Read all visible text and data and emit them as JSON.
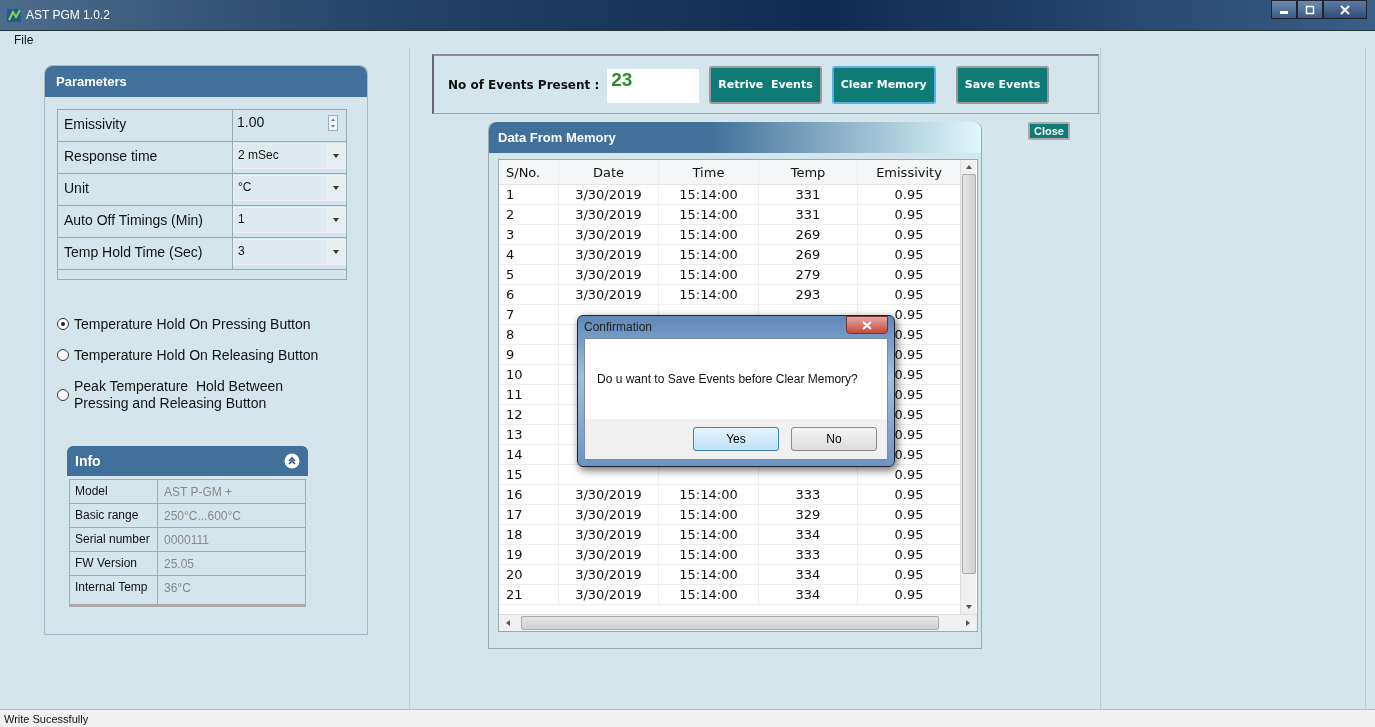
{
  "window": {
    "title": "AST PGM 1.0.2"
  },
  "menu": [
    "File"
  ],
  "parameters": {
    "title": "Parameters",
    "rows": [
      {
        "label": "Emissivity",
        "value": "1.00",
        "kind": "spinner"
      },
      {
        "label": "Response time",
        "value": "2 mSec",
        "kind": "dropdown"
      },
      {
        "label": "Unit",
        "value": "°C",
        "kind": "dropdown"
      },
      {
        "label": "Auto Off Timings (Min)",
        "value": "1",
        "kind": "dropdown"
      },
      {
        "label": "Temp Hold Time (Sec)",
        "value": "3",
        "kind": "dropdown"
      }
    ]
  },
  "hold_modes": [
    {
      "label": "Temperature Hold On Pressing Button",
      "selected": true
    },
    {
      "label": "Temperature Hold On Releasing Button",
      "selected": false
    },
    {
      "label": "Peak Temperature  Hold Between Pressing and Releasing Button",
      "selected": false
    }
  ],
  "info": {
    "title": "Info",
    "rows": [
      {
        "label": "Model",
        "value": "AST P-GM +"
      },
      {
        "label": "Basic range",
        "value": "250°C...600°C"
      },
      {
        "label": "Serial number",
        "value": "0000111"
      },
      {
        "label": "FW Version",
        "value": "25.05"
      },
      {
        "label": "Internal Temp",
        "value": "36°C"
      }
    ]
  },
  "events": {
    "label": "No of Events Present :",
    "count": "23"
  },
  "buttons": [
    {
      "label": "Retrive  Events",
      "focused": false
    },
    {
      "label": "Clear Memory",
      "focused": true
    },
    {
      "label": "Save Events",
      "focused": false
    }
  ],
  "close_button": "Close",
  "data_panel": {
    "title": "Data From Memory",
    "columns": [
      "S/No.",
      "Date",
      "Time",
      "Temp",
      "Emissivity"
    ],
    "rows": [
      {
        "sno": "1",
        "date": "3/30/2019",
        "time": "15:14:00",
        "temp": "331",
        "emissivity": "0.95"
      },
      {
        "sno": "2",
        "date": "3/30/2019",
        "time": "15:14:00",
        "temp": "331",
        "emissivity": "0.95"
      },
      {
        "sno": "3",
        "date": "3/30/2019",
        "time": "15:14:00",
        "temp": "269",
        "emissivity": "0.95"
      },
      {
        "sno": "4",
        "date": "3/30/2019",
        "time": "15:14:00",
        "temp": "269",
        "emissivity": "0.95"
      },
      {
        "sno": "5",
        "date": "3/30/2019",
        "time": "15:14:00",
        "temp": "279",
        "emissivity": "0.95"
      },
      {
        "sno": "6",
        "date": "3/30/2019",
        "time": "15:14:00",
        "temp": "293",
        "emissivity": "0.95"
      },
      {
        "sno": "7",
        "emissivity": "0.95"
      },
      {
        "sno": "8",
        "emissivity": "0.95"
      },
      {
        "sno": "9",
        "emissivity": "0.95"
      },
      {
        "sno": "10",
        "emissivity": "0.95"
      },
      {
        "sno": "11",
        "emissivity": "0.95"
      },
      {
        "sno": "12",
        "emissivity": "0.95"
      },
      {
        "sno": "13",
        "emissivity": "0.95"
      },
      {
        "sno": "14",
        "emissivity": "0.95"
      },
      {
        "sno": "15",
        "emissivity": "0.95"
      },
      {
        "sno": "16",
        "date": "3/30/2019",
        "time": "15:14:00",
        "temp": "333",
        "emissivity": "0.95"
      },
      {
        "sno": "17",
        "date": "3/30/2019",
        "time": "15:14:00",
        "temp": "329",
        "emissivity": "0.95"
      },
      {
        "sno": "18",
        "date": "3/30/2019",
        "time": "15:14:00",
        "temp": "334",
        "emissivity": "0.95"
      },
      {
        "sno": "19",
        "date": "3/30/2019",
        "time": "15:14:00",
        "temp": "333",
        "emissivity": "0.95"
      },
      {
        "sno": "20",
        "date": "3/30/2019",
        "time": "15:14:00",
        "temp": "334",
        "emissivity": "0.95"
      },
      {
        "sno": "21",
        "date": "3/30/2019",
        "time": "15:14:00",
        "temp": "334",
        "emissivity": "0.95"
      }
    ]
  },
  "dialog": {
    "title": "Confirmation",
    "message": "Do u want to Save Events before Clear Memory?",
    "buttons": [
      {
        "label": "Yes",
        "default": true
      },
      {
        "label": "No",
        "default": false
      }
    ]
  },
  "status_bar": "Write Sucessfully"
}
